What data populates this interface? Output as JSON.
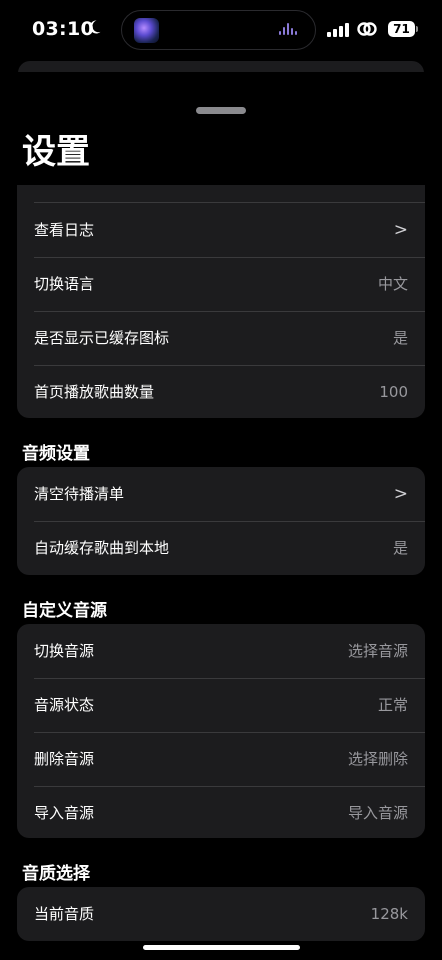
{
  "status_bar": {
    "time": "03:10",
    "battery": "71"
  },
  "page": {
    "title": "设置"
  },
  "general_group": {
    "rows": [
      {
        "label": "查看日志",
        "value": ">"
      },
      {
        "label": "切换语言",
        "value": "中文"
      },
      {
        "label": "是否显示已缓存图标",
        "value": "是"
      },
      {
        "label": "首页播放歌曲数量",
        "value": "100"
      }
    ]
  },
  "audio_settings": {
    "header": "音频设置",
    "rows": [
      {
        "label": "清空待播清单",
        "value": ">"
      },
      {
        "label": "自动缓存歌曲到本地",
        "value": "是"
      }
    ]
  },
  "custom_source": {
    "header": "自定义音源",
    "rows": [
      {
        "label": "切换音源",
        "value": "选择音源"
      },
      {
        "label": "音源状态",
        "value": "正常"
      },
      {
        "label": "删除音源",
        "value": "选择删除"
      },
      {
        "label": "导入音源",
        "value": "导入音源"
      }
    ]
  },
  "quality": {
    "header": "音质选择",
    "rows": [
      {
        "label": "当前音质",
        "value": "128k"
      }
    ]
  },
  "colors": {
    "background": "#000000",
    "group": "#1c1c1e",
    "separator": "#3a3a3c",
    "secondary_text": "#98989d"
  }
}
